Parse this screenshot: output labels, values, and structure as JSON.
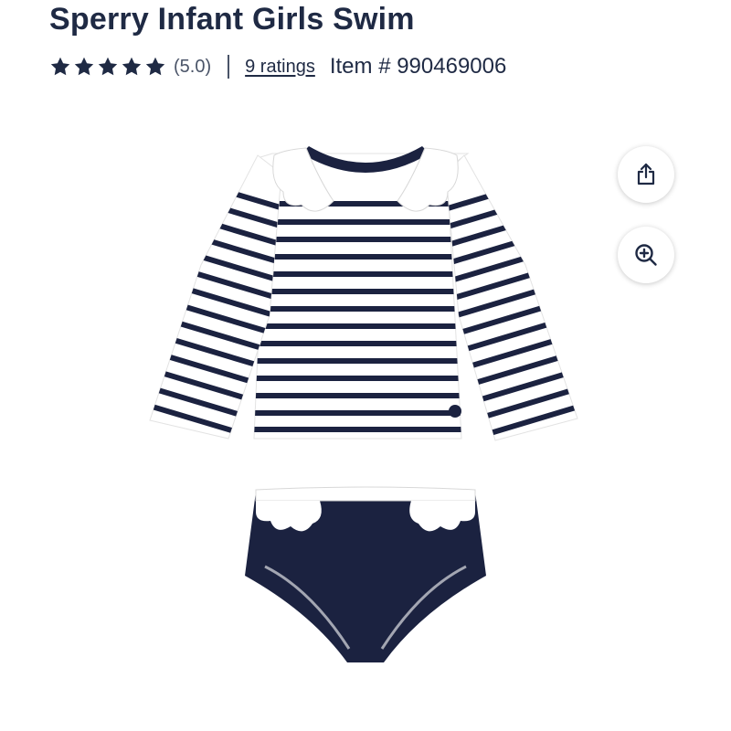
{
  "product": {
    "title": "Sperry Infant Girls Swim",
    "rating_score": "(5.0)",
    "ratings_link": "9 ratings",
    "item_number": "Item # 990469006",
    "star_count": 5
  },
  "actions": {
    "share_icon": "share-icon",
    "zoom_icon": "zoom-in-icon"
  },
  "colors": {
    "text": "#1f2a44",
    "navy": "#1b2240",
    "white": "#ffffff"
  }
}
